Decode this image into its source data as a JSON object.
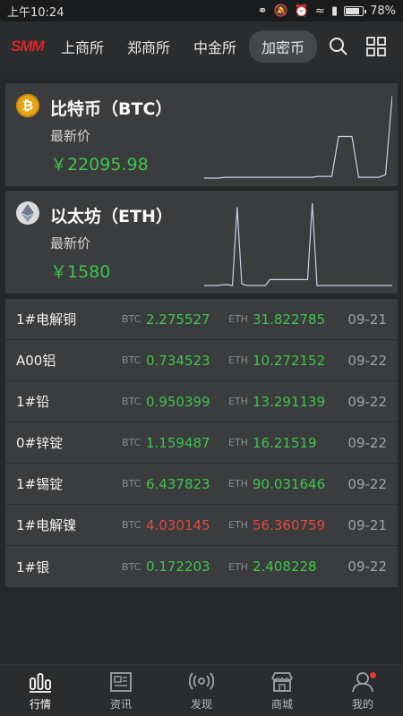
{
  "status_bar": {
    "time": "上午10:24",
    "battery": "78%"
  },
  "nav": {
    "logo": "SMM",
    "tabs": [
      {
        "label": "上商所"
      },
      {
        "label": "郑商所"
      },
      {
        "label": "中金所"
      },
      {
        "label": "加密币",
        "active": true
      }
    ],
    "icons": [
      "search-icon",
      "grid-icon"
    ]
  },
  "coins": [
    {
      "name": "比特币（BTC）",
      "label": "最新价",
      "price": "￥22095.98",
      "icon": "bitcoin-icon",
      "spark": [
        3,
        3,
        3,
        4,
        4,
        4,
        4,
        4,
        4,
        4,
        4,
        4,
        4,
        4,
        4,
        4,
        4,
        5,
        5,
        5,
        52,
        52,
        52,
        4,
        4,
        4,
        4,
        7,
        100
      ]
    },
    {
      "name": "以太坊（ETH）",
      "label": "最新价",
      "price": "￥1580",
      "icon": "ethereum-icon",
      "spark": [
        3,
        3,
        3,
        3,
        4,
        4,
        3,
        95,
        5,
        3,
        3,
        3,
        3,
        3,
        10,
        10,
        10,
        10,
        10,
        10,
        10,
        10,
        10,
        100,
        3,
        3,
        3,
        3,
        3,
        3,
        3,
        3,
        3,
        3,
        3,
        3,
        3,
        3,
        3,
        3,
        3
      ]
    }
  ],
  "table": {
    "btc_tag": "BTC",
    "eth_tag": "ETH",
    "rows": [
      {
        "name": "1#电解铜",
        "btc": "2.275527",
        "eth": "31.822785",
        "date": "09-21",
        "trend": "up"
      },
      {
        "name": "A00铝",
        "btc": "0.734523",
        "eth": "10.272152",
        "date": "09-22",
        "trend": "up"
      },
      {
        "name": "1#铅",
        "btc": "0.950399",
        "eth": "13.291139",
        "date": "09-22",
        "trend": "up"
      },
      {
        "name": "0#锌锭",
        "btc": "1.159487",
        "eth": "16.21519",
        "date": "09-22",
        "trend": "up"
      },
      {
        "name": "1#锡锭",
        "btc": "6.437823",
        "eth": "90.031646",
        "date": "09-22",
        "trend": "up"
      },
      {
        "name": "1#电解镍",
        "btc": "4.030145",
        "eth": "56.360759",
        "date": "09-21",
        "trend": "down"
      },
      {
        "name": "1#银",
        "btc": "0.172203",
        "eth": "2.408228",
        "date": "09-22",
        "trend": "up"
      }
    ]
  },
  "bottom_nav": [
    {
      "label": "行情",
      "icon": "chart-bars-icon",
      "active": true
    },
    {
      "label": "资讯",
      "icon": "newspaper-icon"
    },
    {
      "label": "发现",
      "icon": "broadcast-icon"
    },
    {
      "label": "商城",
      "icon": "store-icon"
    },
    {
      "label": "我的",
      "icon": "user-icon",
      "badge": true
    }
  ],
  "colors": {
    "up": "#3fc64b",
    "down": "#e04a3f",
    "accent": "#d8262b"
  }
}
